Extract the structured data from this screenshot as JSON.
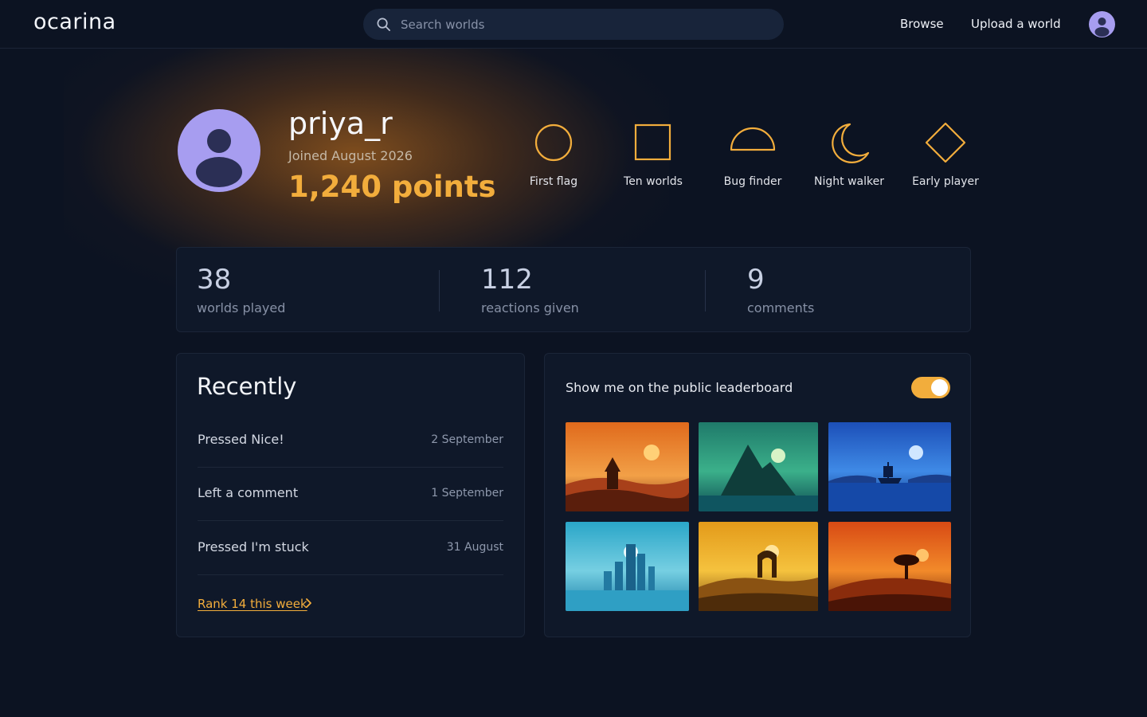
{
  "app": {
    "logo": "ocarina"
  },
  "search": {
    "placeholder": "Search worlds",
    "value": ""
  },
  "nav": {
    "browse": "Browse",
    "upload": "Upload a world"
  },
  "profile": {
    "username": "priya_r",
    "joined": "Joined August 2026",
    "points": "1,240 points"
  },
  "badges": [
    {
      "label": "First flag",
      "icon": "circle-icon"
    },
    {
      "label": "Ten worlds",
      "icon": "square-icon"
    },
    {
      "label": "Bug finder",
      "icon": "half-circle-icon"
    },
    {
      "label": "Night walker",
      "icon": "moon-icon"
    },
    {
      "label": "Early player",
      "icon": "diamond-icon"
    }
  ],
  "stats": [
    {
      "value": "38",
      "label": "worlds played"
    },
    {
      "value": "112",
      "label": "reactions given"
    },
    {
      "value": "9",
      "label": "comments"
    }
  ],
  "recent": {
    "title": "Recently",
    "items": [
      {
        "text": "Pressed Nice!",
        "date": "2 September"
      },
      {
        "text": "Left a comment",
        "date": "1 September"
      },
      {
        "text": "Pressed I'm stuck",
        "date": "31 August"
      }
    ],
    "rank_link": "Rank 14 this week"
  },
  "leaderboard": {
    "label": "Show me on the public leaderboard",
    "toggle_on": true
  },
  "thumbnails": [
    {
      "name": "orange-tower-world"
    },
    {
      "name": "green-mountain-world"
    },
    {
      "name": "blue-ship-world"
    },
    {
      "name": "cyan-city-world"
    },
    {
      "name": "gold-arch-world"
    },
    {
      "name": "red-tree-world"
    }
  ],
  "colors": {
    "accent": "#f2ad3c",
    "background": "#0c1322",
    "panel": "#0f1829",
    "avatar": "#a79df0"
  }
}
